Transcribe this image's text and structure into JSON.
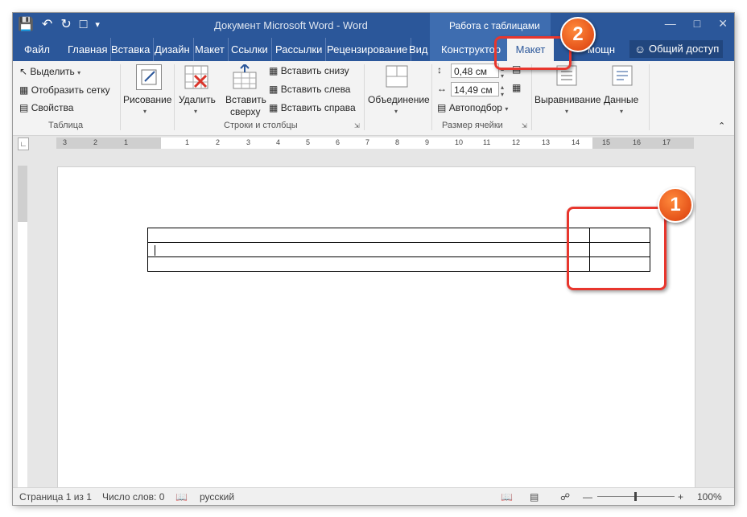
{
  "titlebar": {
    "doc_title": "Документ Microsoft Word - Word",
    "context_title": "Работа с таблицами",
    "qat": [
      "save-icon",
      "undo-icon",
      "redo-icon",
      "new-doc-icon",
      "customize-qat-icon"
    ]
  },
  "tabs": [
    {
      "label": "Файл"
    },
    {
      "label": "Главная"
    },
    {
      "label": "Вставка"
    },
    {
      "label": "Дизайн"
    },
    {
      "label": "Макет"
    },
    {
      "label": "Ссылки"
    },
    {
      "label": "Рассылки"
    },
    {
      "label": "Рецензирование"
    },
    {
      "label": "Вид"
    },
    {
      "label": "Конструктор"
    },
    {
      "label": "Макет"
    },
    {
      "label": "мощн"
    }
  ],
  "share_label": "Общий доступ",
  "ribbon": {
    "table_group": {
      "select": "Выделить",
      "show_grid": "Отобразить сетку",
      "properties": "Свойства",
      "label": "Таблица"
    },
    "draw": "Рисование",
    "delete": "Удалить",
    "insert_above_1": "Вставить",
    "insert_above_2": "сверху",
    "insert_below": "Вставить снизу",
    "insert_left": "Вставить слева",
    "insert_right": "Вставить справа",
    "rows_cols_label": "Строки и столбцы",
    "merge": "Объединение",
    "height": "0,48 см",
    "width": "14,49 см",
    "autofit": "Автоподбор",
    "cell_size_label": "Размер ячейки",
    "alignment": "Выравнивание",
    "data": "Данные"
  },
  "ruler_numbers": [
    "3",
    "2",
    "1",
    "1",
    "2",
    "3",
    "4",
    "5",
    "6",
    "7",
    "8",
    "9",
    "10",
    "11",
    "12",
    "13",
    "14",
    "15",
    "16",
    "17"
  ],
  "status": {
    "page": "Страница 1 из 1",
    "words": "Число слов: 0",
    "language": "русский",
    "zoom": "100%"
  },
  "callouts": {
    "one": "1",
    "two": "2"
  },
  "colors": {
    "brand": "#2b579a",
    "context": "#3e6db0",
    "highlight": "#e8362d",
    "badge": "#e5531a"
  }
}
